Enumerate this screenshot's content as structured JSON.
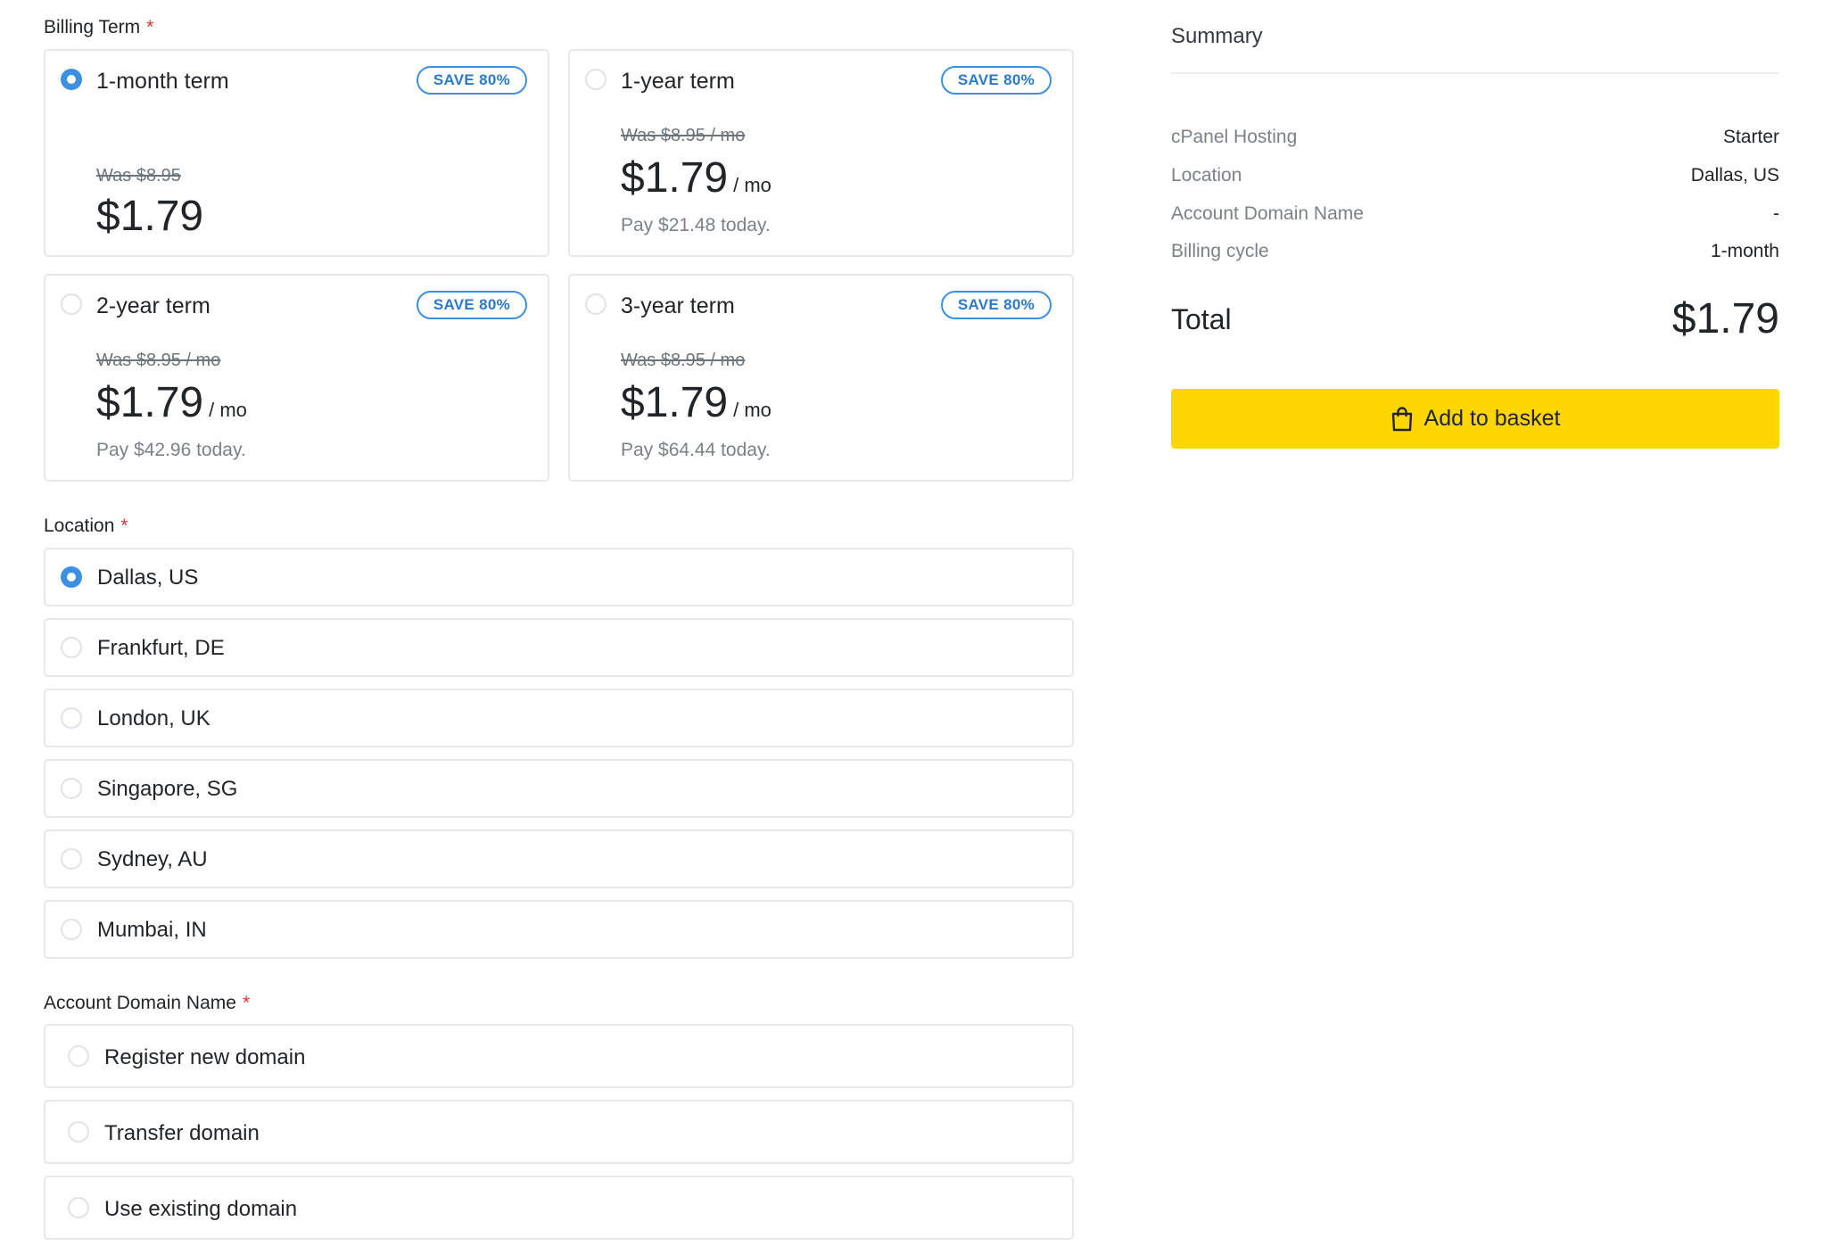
{
  "billing": {
    "label": "Billing Term",
    "required_marker": "*",
    "terms": [
      {
        "title": "1-month term",
        "badge": "SAVE 80%",
        "was": "Was $8.95",
        "price": "$1.79",
        "per": "",
        "pay": "",
        "selected": true
      },
      {
        "title": "1-year term",
        "badge": "SAVE 80%",
        "was": "Was $8.95 / mo",
        "price": "$1.79",
        "per": "/ mo",
        "pay": "Pay $21.48 today.",
        "selected": false
      },
      {
        "title": "2-year term",
        "badge": "SAVE 80%",
        "was": "Was $8.95 / mo",
        "price": "$1.79",
        "per": "/ mo",
        "pay": "Pay $42.96 today.",
        "selected": false
      },
      {
        "title": "3-year term",
        "badge": "SAVE 80%",
        "was": "Was $8.95 / mo",
        "price": "$1.79",
        "per": "/ mo",
        "pay": "Pay $64.44 today.",
        "selected": false
      }
    ]
  },
  "location": {
    "label": "Location",
    "required_marker": "*",
    "options": [
      {
        "label": "Dallas, US",
        "selected": true
      },
      {
        "label": "Frankfurt, DE",
        "selected": false
      },
      {
        "label": "London, UK",
        "selected": false
      },
      {
        "label": "Singapore, SG",
        "selected": false
      },
      {
        "label": "Sydney, AU",
        "selected": false
      },
      {
        "label": "Mumbai, IN",
        "selected": false
      }
    ]
  },
  "domain": {
    "label": "Account Domain Name",
    "required_marker": "*",
    "options": [
      {
        "label": "Register new domain",
        "selected": false
      },
      {
        "label": "Transfer domain",
        "selected": false
      },
      {
        "label": "Use existing domain",
        "selected": false
      }
    ]
  },
  "summary": {
    "title": "Summary",
    "rows": [
      {
        "label": "cPanel Hosting",
        "value": "Starter"
      },
      {
        "label": "Location",
        "value": "Dallas, US"
      },
      {
        "label": "Account Domain Name",
        "value": "-"
      },
      {
        "label": "Billing cycle",
        "value": "1-month"
      }
    ],
    "total_label": "Total",
    "total_value": "$1.79",
    "button_label": "Add to basket",
    "button_icon": "shopping-bag-icon"
  },
  "colors": {
    "accent": "#3d8fe0",
    "button": "#ffd600",
    "required": "#e03131",
    "border": "#e6e8eb"
  }
}
